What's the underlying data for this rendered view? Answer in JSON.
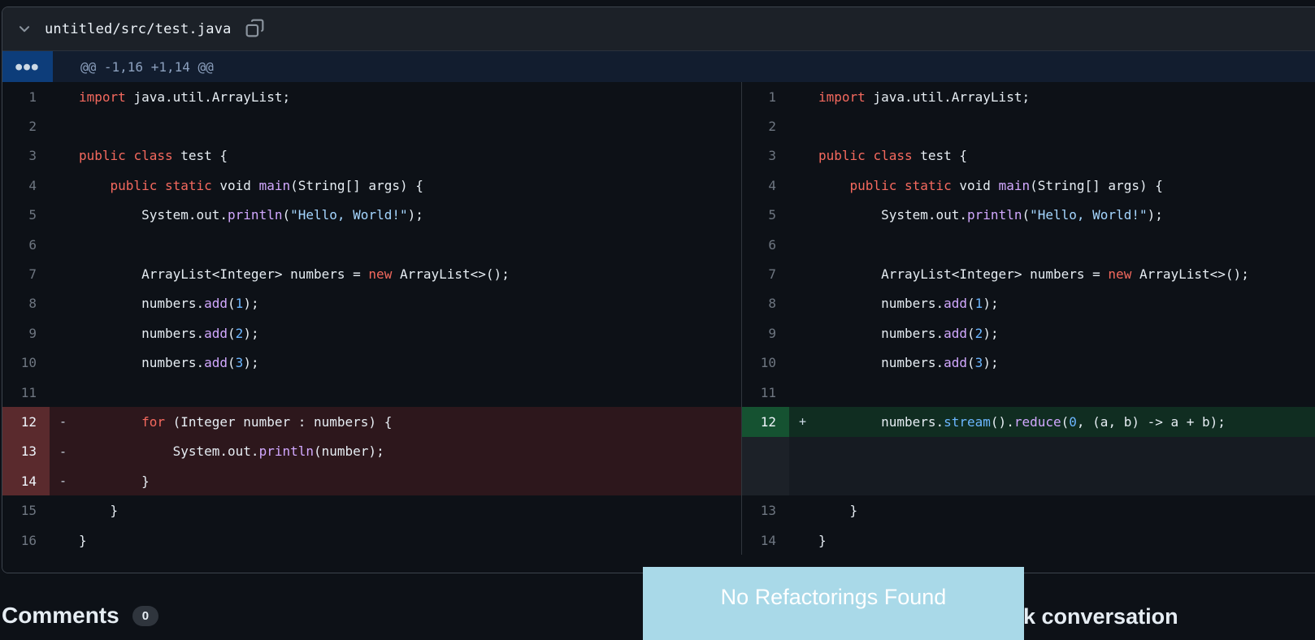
{
  "file_header": {
    "path": "untitled/src/test.java",
    "collapse_icon": "chevron-down-icon",
    "copy_icon": "copy-icon"
  },
  "hunk": {
    "expand_icon": "ellipsis-icon",
    "header": "@@ -1,16 +1,14 @@"
  },
  "colors": {
    "page_bg": "#0d1117",
    "panel_border": "#3d444d",
    "file_header_bg": "#1c2128",
    "hunk_bg": "#121d2f",
    "hunk_button_bg": "#0d3d7a",
    "removed_gutter_bg": "#5a2a2d",
    "removed_line_bg": "#2d171c",
    "added_gutter_bg": "#155231",
    "added_line_bg": "#102d21",
    "filler_bg": "#161b22",
    "toast_bg": "#a9d9e8",
    "keyword": "#f4695e",
    "method": "#d2a8ff",
    "constant": "#6cb6ff",
    "string": "#a5d6ff",
    "plain": "#e6edf3"
  },
  "diff": {
    "left_rows": [
      {
        "num": "1",
        "type": "context",
        "marker": "",
        "tokens": [
          [
            "import",
            "k"
          ],
          [
            " java.util.ArrayList;",
            "p"
          ]
        ]
      },
      {
        "num": "2",
        "type": "context",
        "marker": "",
        "tokens": []
      },
      {
        "num": "3",
        "type": "context",
        "marker": "",
        "tokens": [
          [
            "public",
            "k"
          ],
          [
            " ",
            "p"
          ],
          [
            "class",
            "k"
          ],
          [
            " test {",
            "p"
          ]
        ]
      },
      {
        "num": "4",
        "type": "context",
        "marker": "",
        "tokens": [
          [
            "    ",
            "p"
          ],
          [
            "public",
            "k"
          ],
          [
            " ",
            "p"
          ],
          [
            "static",
            "k"
          ],
          [
            " void ",
            "p"
          ],
          [
            "main",
            "f"
          ],
          [
            "(String[] args) {",
            "p"
          ]
        ]
      },
      {
        "num": "5",
        "type": "context",
        "marker": "",
        "tokens": [
          [
            "        System.out.",
            "p"
          ],
          [
            "println",
            "f"
          ],
          [
            "(",
            "p"
          ],
          [
            "\"Hello, World!\"",
            "s"
          ],
          [
            ");",
            "p"
          ]
        ]
      },
      {
        "num": "6",
        "type": "context",
        "marker": "",
        "tokens": []
      },
      {
        "num": "7",
        "type": "context",
        "marker": "",
        "tokens": [
          [
            "        ArrayList<Integer> numbers = ",
            "p"
          ],
          [
            "new",
            "k"
          ],
          [
            " ArrayList<>();",
            "p"
          ]
        ]
      },
      {
        "num": "8",
        "type": "context",
        "marker": "",
        "tokens": [
          [
            "        numbers.",
            "p"
          ],
          [
            "add",
            "f"
          ],
          [
            "(",
            "p"
          ],
          [
            "1",
            "c"
          ],
          [
            ");",
            "p"
          ]
        ]
      },
      {
        "num": "9",
        "type": "context",
        "marker": "",
        "tokens": [
          [
            "        numbers.",
            "p"
          ],
          [
            "add",
            "f"
          ],
          [
            "(",
            "p"
          ],
          [
            "2",
            "c"
          ],
          [
            ");",
            "p"
          ]
        ]
      },
      {
        "num": "10",
        "type": "context",
        "marker": "",
        "tokens": [
          [
            "        numbers.",
            "p"
          ],
          [
            "add",
            "f"
          ],
          [
            "(",
            "p"
          ],
          [
            "3",
            "c"
          ],
          [
            ");",
            "p"
          ]
        ]
      },
      {
        "num": "11",
        "type": "context",
        "marker": "",
        "tokens": []
      },
      {
        "num": "12",
        "type": "removed",
        "marker": "-",
        "tokens": [
          [
            "        ",
            "p"
          ],
          [
            "for",
            "k"
          ],
          [
            " (Integer number : numbers) {",
            "p"
          ]
        ]
      },
      {
        "num": "13",
        "type": "removed",
        "marker": "-",
        "tokens": [
          [
            "            System.out.",
            "p"
          ],
          [
            "println",
            "f"
          ],
          [
            "(number);",
            "p"
          ]
        ]
      },
      {
        "num": "14",
        "type": "removed",
        "marker": "-",
        "tokens": [
          [
            "        }",
            "p"
          ]
        ]
      },
      {
        "num": "15",
        "type": "context",
        "marker": "",
        "tokens": [
          [
            "    }",
            "p"
          ]
        ]
      },
      {
        "num": "16",
        "type": "context",
        "marker": "",
        "tokens": [
          [
            "}",
            "p"
          ]
        ]
      }
    ],
    "right_rows": [
      {
        "num": "1",
        "type": "context",
        "marker": "",
        "tokens": [
          [
            "import",
            "k"
          ],
          [
            " java.util.ArrayList;",
            "p"
          ]
        ]
      },
      {
        "num": "2",
        "type": "context",
        "marker": "",
        "tokens": []
      },
      {
        "num": "3",
        "type": "context",
        "marker": "",
        "tokens": [
          [
            "public",
            "k"
          ],
          [
            " ",
            "p"
          ],
          [
            "class",
            "k"
          ],
          [
            " test {",
            "p"
          ]
        ]
      },
      {
        "num": "4",
        "type": "context",
        "marker": "",
        "tokens": [
          [
            "    ",
            "p"
          ],
          [
            "public",
            "k"
          ],
          [
            " ",
            "p"
          ],
          [
            "static",
            "k"
          ],
          [
            " void ",
            "p"
          ],
          [
            "main",
            "f"
          ],
          [
            "(String[] args) {",
            "p"
          ]
        ]
      },
      {
        "num": "5",
        "type": "context",
        "marker": "",
        "tokens": [
          [
            "        System.out.",
            "p"
          ],
          [
            "println",
            "f"
          ],
          [
            "(",
            "p"
          ],
          [
            "\"Hello, World!\"",
            "s"
          ],
          [
            ");",
            "p"
          ]
        ]
      },
      {
        "num": "6",
        "type": "context",
        "marker": "",
        "tokens": []
      },
      {
        "num": "7",
        "type": "context",
        "marker": "",
        "tokens": [
          [
            "        ArrayList<Integer> numbers = ",
            "p"
          ],
          [
            "new",
            "k"
          ],
          [
            " ArrayList<>();",
            "p"
          ]
        ]
      },
      {
        "num": "8",
        "type": "context",
        "marker": "",
        "tokens": [
          [
            "        numbers.",
            "p"
          ],
          [
            "add",
            "f"
          ],
          [
            "(",
            "p"
          ],
          [
            "1",
            "c"
          ],
          [
            ");",
            "p"
          ]
        ]
      },
      {
        "num": "9",
        "type": "context",
        "marker": "",
        "tokens": [
          [
            "        numbers.",
            "p"
          ],
          [
            "add",
            "f"
          ],
          [
            "(",
            "p"
          ],
          [
            "2",
            "c"
          ],
          [
            ");",
            "p"
          ]
        ]
      },
      {
        "num": "10",
        "type": "context",
        "marker": "",
        "tokens": [
          [
            "        numbers.",
            "p"
          ],
          [
            "add",
            "f"
          ],
          [
            "(",
            "p"
          ],
          [
            "3",
            "c"
          ],
          [
            ");",
            "p"
          ]
        ]
      },
      {
        "num": "11",
        "type": "context",
        "marker": "",
        "tokens": []
      },
      {
        "num": "12",
        "type": "added",
        "marker": "+",
        "tokens": [
          [
            "        numbers.",
            "p"
          ],
          [
            "stream",
            "c"
          ],
          [
            "().",
            "p"
          ],
          [
            "reduce",
            "f"
          ],
          [
            "(",
            "p"
          ],
          [
            "0",
            "c"
          ],
          [
            ", (a, b) -> a + b);",
            "p"
          ]
        ]
      },
      {
        "num": "",
        "type": "filler",
        "marker": "",
        "tokens": []
      },
      {
        "num": "",
        "type": "filler",
        "marker": "",
        "tokens": []
      },
      {
        "num": "13",
        "type": "context",
        "marker": "",
        "tokens": [
          [
            "    }",
            "p"
          ]
        ]
      },
      {
        "num": "14",
        "type": "context",
        "marker": "",
        "tokens": [
          [
            "}",
            "p"
          ]
        ]
      }
    ]
  },
  "toast": {
    "label": "No Refactorings Found"
  },
  "comments": {
    "title": "Comments",
    "count": "0"
  },
  "partial_text": "k conversation"
}
